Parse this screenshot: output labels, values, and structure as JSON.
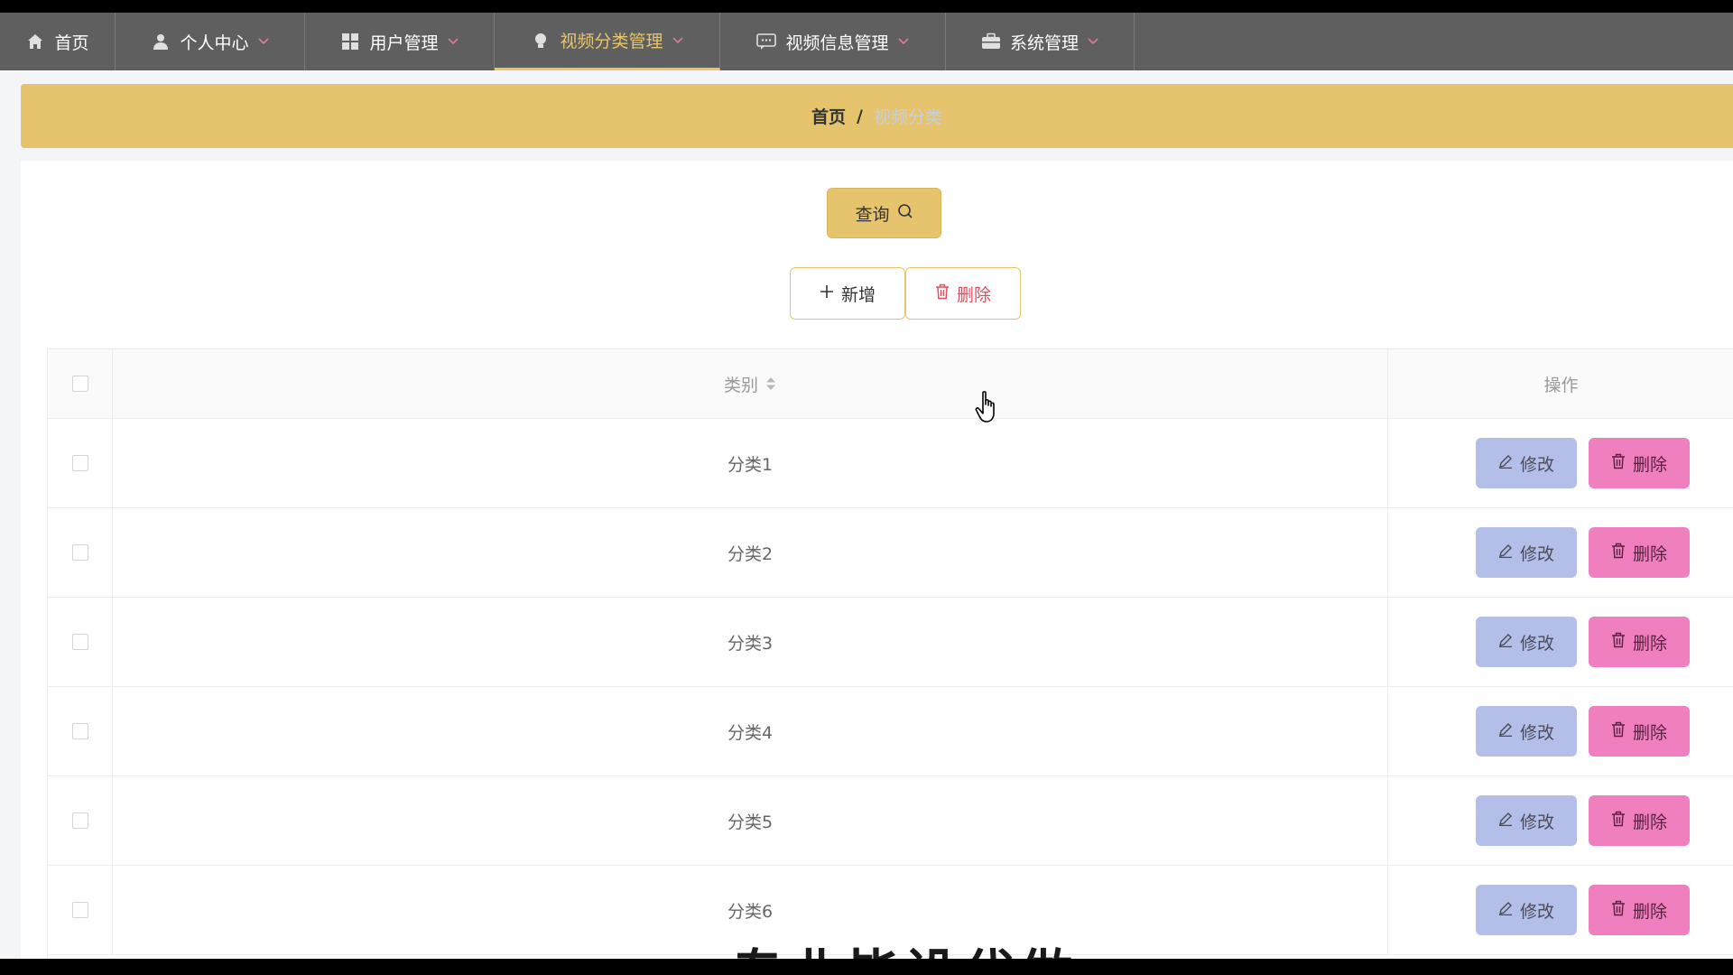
{
  "nav": {
    "items": [
      {
        "label": "首页",
        "icon": "home-icon"
      },
      {
        "label": "个人中心",
        "icon": "user-icon"
      },
      {
        "label": "用户管理",
        "icon": "grid-icon"
      },
      {
        "label": "视频分类管理",
        "icon": "bulb-icon"
      },
      {
        "label": "视频信息管理",
        "icon": "message-icon"
      },
      {
        "label": "系统管理",
        "icon": "briefcase-icon"
      }
    ],
    "active_index": 3
  },
  "breadcrumb": {
    "home": "首页",
    "separator": "/",
    "current": "视频分类"
  },
  "toolbar": {
    "query_label": "查询",
    "add_label": "新增",
    "delete_label": "删除"
  },
  "table": {
    "headers": {
      "category": "类别",
      "actions": "操作"
    },
    "rows": [
      {
        "category": "分类1"
      },
      {
        "category": "分类2"
      },
      {
        "category": "分类3"
      },
      {
        "category": "分类4"
      },
      {
        "category": "分类5"
      },
      {
        "category": "分类6"
      }
    ],
    "edit_label": "修改",
    "delete_label": "删除"
  },
  "overlay": {
    "text": "专业毕设代做"
  },
  "colors": {
    "nav_bg": "#5f5f5f",
    "accent": "#e6c46d",
    "edit_btn": "#b4bfe9",
    "delete_btn": "#ef7fbf",
    "danger_text": "#e84a5f"
  }
}
